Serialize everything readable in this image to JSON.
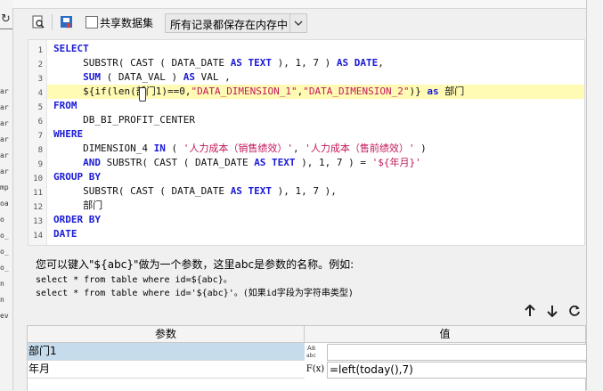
{
  "left_fragments": [
    "ar",
    "ar",
    "ar",
    "ar",
    "ar",
    "ar",
    "mp",
    "oa",
    "o",
    "o_",
    "o_",
    "o_",
    "n",
    "n",
    "ev"
  ],
  "toolbar": {
    "share_dataset_label": "共享数据集",
    "storage_select_value": "所有记录都保存在内存中"
  },
  "editor": {
    "line_numbers": [
      "1",
      "2",
      "3",
      "4",
      "5",
      "6",
      "7",
      "8",
      "9",
      "10",
      "11",
      "12",
      "13",
      "14"
    ],
    "lines": {
      "l1": {
        "kw": "SELECT"
      },
      "l2": {
        "pre": "     SUBSTR( CAST ( DATA_DATE ",
        "kw1": "AS TEXT",
        "mid": " ), 1, 7 ) ",
        "kw2": "AS DATE",
        ",": ","
      },
      "l3": {
        "pre": "     ",
        "kw1": "SUM",
        "mid": " ( DATA_VAL ) ",
        "kw2": "AS",
        "post": " VAL ,"
      },
      "l4": {
        "pre": "     ${if(len(部门1)==0,",
        "s1": "\"DATA_DIMENSION_1\"",
        ",": ",",
        "s2": "\"DATA_DIMENSION_2\"",
        "mid": ")} ",
        "kw": "as",
        "post": " 部门"
      },
      "l5": {
        "kw": "FROM"
      },
      "l6": {
        "text": "     DB_BI_PROFIT_CENTER"
      },
      "l7": {
        "kw": "WHERE"
      },
      "l8": {
        "pre": "     DIMENSION_4 ",
        "kw": "IN",
        "mid": " ( ",
        "s1": "'人力成本（销售绩效）'",
        ",": ", ",
        "s2": "'人力成本（售前绩效）'",
        "post": " )"
      },
      "l9": {
        "pre": "     ",
        "kw1": "AND",
        "mid": " SUBSTR( CAST ( DATA_DATE ",
        "kw2": "AS TEXT",
        "mid2": " ), 1, 7 ) = ",
        "s": "'${年月}'"
      },
      "l10": {
        "kw": "GROUP BY"
      },
      "l11": {
        "pre": "     SUBSTR( CAST ( DATA_DATE ",
        "kw": "AS TEXT",
        "post": " ), 1, 7 ),"
      },
      "l12": {
        "text": "     部门"
      },
      "l13": {
        "kw": "ORDER BY"
      },
      "l14": {
        "kw": "DATE"
      }
    }
  },
  "hint": {
    "line1": "您可以键入\"${abc}\"做为一个参数，这里abc是参数的名称。例如:",
    "line2": "select * from table where id=${abc}。",
    "line3": "select * from table where id='${abc}'。(如果id字段为字符串类型)"
  },
  "params": {
    "header_name": "参数",
    "header_value": "值",
    "rows": [
      {
        "name": "部门1",
        "type_icon": "abc-text-icon",
        "value": ""
      },
      {
        "name": "年月",
        "type_icon": "formula-icon",
        "type_label": "F(x)",
        "value": "=left(today(),7)"
      }
    ]
  },
  "colors": {
    "keyword": "#1a1ad6",
    "string": "#c2185b",
    "highlight": "#fffbb5",
    "selected_row": "#c6dcec"
  }
}
